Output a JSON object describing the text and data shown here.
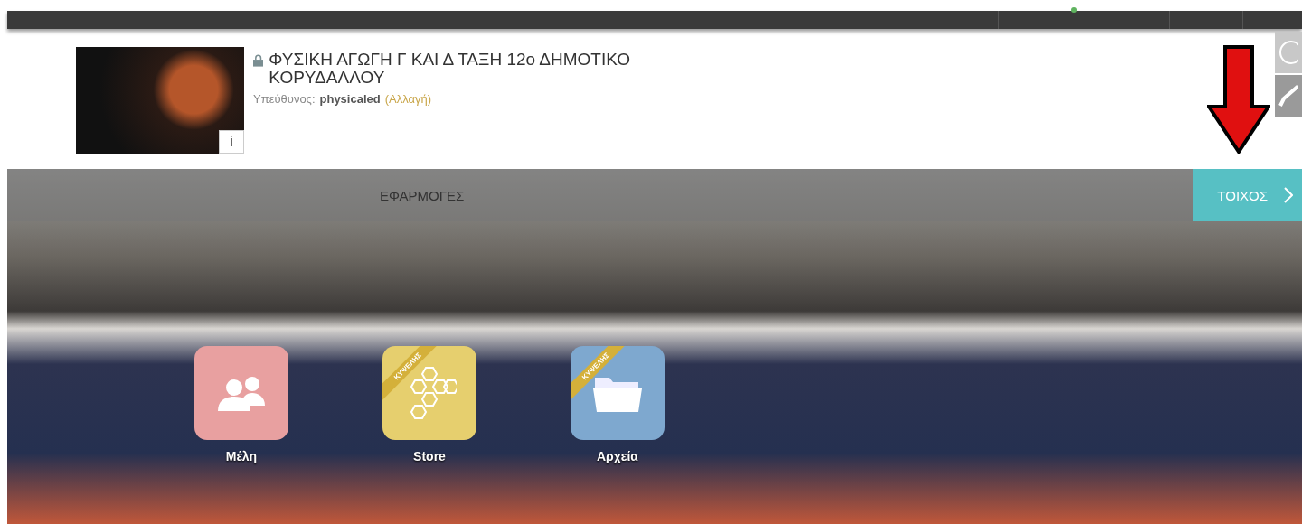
{
  "course": {
    "title": "ΦΥΣΙΚΗ ΑΓΩΓΗ Γ ΚΑΙ Δ ΤΑΞΗ 12ο ΔΗΜΟΤΙΚΟ ΚΟΡΥΔΑΛΛΟΥ",
    "locked": true,
    "owner_label": "Υπεύθυνος:",
    "owner": "physicaled",
    "change_link": "(Αλλαγή)",
    "info": "i"
  },
  "tabs": [
    {
      "label": "ΕΦΑΡΜΟΓΕΣ",
      "selected": false
    },
    {
      "label": "ΤΟΙΧΟΣ",
      "selected": true
    }
  ],
  "apps": [
    {
      "kind": "members",
      "label": "Μέλη",
      "color": "#e8a0a0"
    },
    {
      "kind": "store",
      "label": "Store",
      "color": "#e6cf6e",
      "ribbon": "ΚΥΨΕΛΗΣ"
    },
    {
      "kind": "files",
      "label": "Αρχεία",
      "color": "#7ea8cf",
      "ribbon": "ΚΥΨΕΛΗΣ"
    }
  ]
}
